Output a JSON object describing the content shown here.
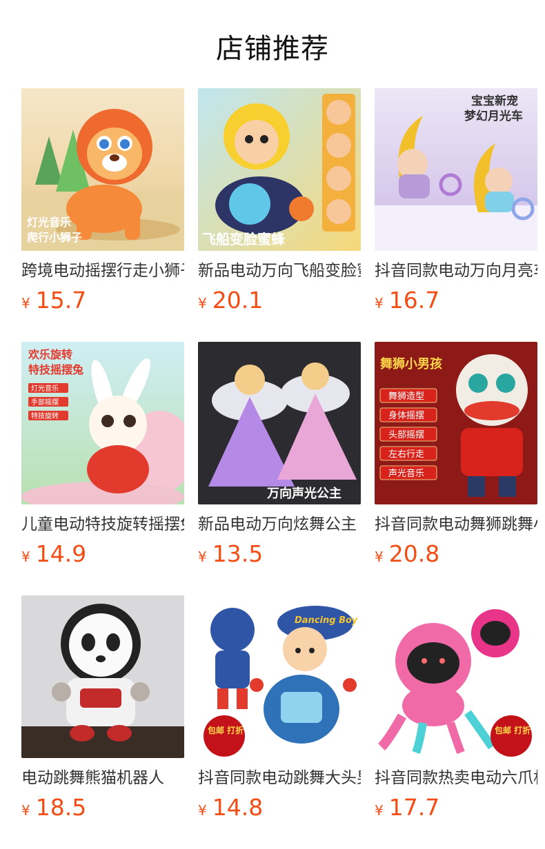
{
  "page": {
    "title": "店铺推荐"
  },
  "products": [
    {
      "name": "跨境电动摇摆行走小狮子",
      "currency": "¥",
      "price": "15.7",
      "image_text": [
        "灯光音乐",
        "爬行小狮子"
      ],
      "image_badge": "",
      "icon": "lion-toy-image"
    },
    {
      "name": "新品电动万向飞船变脸蜜蜂",
      "currency": "¥",
      "price": "20.1",
      "image_text": [
        "飞船变脸蜜蜂"
      ],
      "image_badge": "",
      "icon": "bee-toy-image"
    },
    {
      "name": "抖音同款电动万向月亮车",
      "currency": "¥",
      "price": "16.7",
      "image_text": [
        "宝宝新宠",
        "梦幻月光车"
      ],
      "image_badge": "",
      "icon": "moon-car-toy-image"
    },
    {
      "name": "儿童电动特技旋转摇摆兔",
      "currency": "¥",
      "price": "14.9",
      "image_text": [
        "欢乐旋转",
        "特技摇摆兔",
        "灯光音乐",
        "手部摇摆",
        "特技旋转"
      ],
      "image_badge": "",
      "icon": "rabbit-toy-image"
    },
    {
      "name": "新品电动万向炫舞公主",
      "currency": "¥",
      "price": "13.5",
      "image_text": [
        "万向声光公主"
      ],
      "image_badge": "",
      "icon": "princess-toy-image"
    },
    {
      "name": "抖音同款电动舞狮跳舞小男孩",
      "currency": "¥",
      "price": "20.8",
      "image_text": [
        "舞狮小男孩",
        "舞狮造型",
        "身体摇摆",
        "头部摇摆",
        "左右行走",
        "声光音乐"
      ],
      "image_badge": "",
      "icon": "lion-dance-toy-image"
    },
    {
      "name": "电动跳舞熊猫机器人",
      "currency": "¥",
      "price": "18.5",
      "image_text": [],
      "image_badge": "",
      "icon": "panda-robot-toy-image"
    },
    {
      "name": "抖音同款电动跳舞大头男孩",
      "currency": "¥",
      "price": "14.8",
      "image_text": [
        "Dancing Boy"
      ],
      "image_badge": "包邮 打折",
      "icon": "dancing-boy-toy-image"
    },
    {
      "name": "抖音同款热卖电动六爪机器人",
      "currency": "¥",
      "price": "17.7",
      "image_text": [],
      "image_badge": "包邮 打折",
      "icon": "octopus-robot-toy-image"
    }
  ],
  "colors": {
    "price": "#f14d14",
    "text": "#333333",
    "title": "#111111"
  }
}
